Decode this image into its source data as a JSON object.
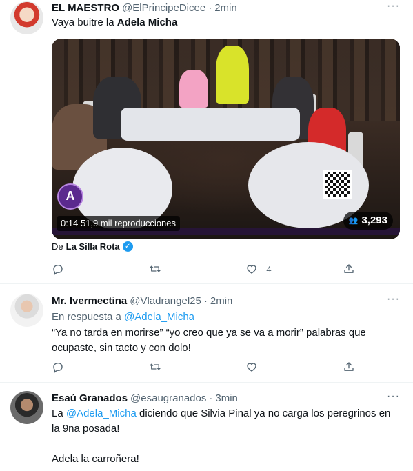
{
  "tweets": [
    {
      "name": "EL MAESTRO",
      "handle": "@ElPrincipeDicee",
      "separator": "·",
      "time": "2min",
      "text_prefix": "Vaya buitre la ",
      "text_bold": "Adela Micha",
      "media": {
        "counter_time": "0:14",
        "counter_views": "51,9 mil reproducciones",
        "view_count": "3,293",
        "logo_letter": "A"
      },
      "source_prefix": "De",
      "source_name": "La Silla Rota",
      "actions": {
        "reply": "",
        "retweet": "",
        "like": "4"
      }
    },
    {
      "name": "Mr. Ivermectina",
      "handle": "@Vladrangel25",
      "separator": "·",
      "time": "2min",
      "reply_prefix": "En respuesta a ",
      "reply_mention": "@Adela_Micha",
      "text": "“Ya no tarda en morirse” “yo creo que ya se va a morir” palabras que ocupaste, sin tacto y con dolo!",
      "actions": {
        "reply": "",
        "retweet": "",
        "like": ""
      }
    },
    {
      "name": "Esaú Granados",
      "handle": "@esaugranados",
      "separator": "·",
      "time": "3min",
      "text_prefix": "La ",
      "text_mention": "@Adela_Micha",
      "text_rest": " diciendo que Silvia Pinal ya no carga los peregrinos en la 9na posada!",
      "text_line2": "Adela la carroñera!"
    }
  ],
  "icons": [
    "more-icon",
    "reply-icon",
    "retweet-icon",
    "like-icon",
    "share-icon",
    "verified-icon"
  ],
  "colors": {
    "accent": "#1d9bf0",
    "muted": "#536471",
    "text": "#0f1419"
  }
}
